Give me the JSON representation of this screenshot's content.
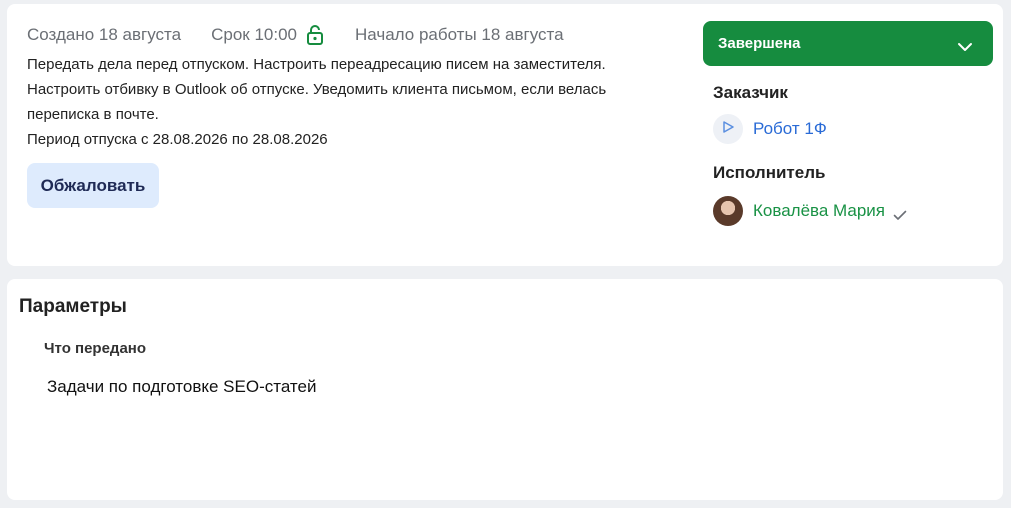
{
  "task": {
    "created": "Создано 18 августа",
    "deadline": "Срок 10:00",
    "start": "Начало работы 18 августа",
    "description_lines": [
      "Передать дела перед отпуском. Настроить переадресацию писем на заместителя.",
      "Настроить отбивку в Outlook об отпуске. Уведомить клиента письмом, если велась",
      "переписка в почте.",
      "Период отпуска с 28.08.2026 по 28.08.2026"
    ],
    "appeal_label": "Обжаловать"
  },
  "status": {
    "label": "Завершена",
    "color": "#168c3f"
  },
  "customer": {
    "heading": "Заказчик",
    "name": "Робот 1Ф",
    "icon": "play-icon"
  },
  "executor": {
    "heading": "Исполнитель",
    "name": "Ковалёва Мария",
    "icon": "check-icon"
  },
  "params": {
    "title": "Параметры",
    "fields": [
      {
        "label": "Что передано",
        "value": "Задачи по подготовке SEO-статей"
      }
    ]
  },
  "colors": {
    "accent_green": "#168c3f",
    "link_blue": "#2a6bd6",
    "executor_green": "#199245",
    "button_bg": "#deebfd"
  }
}
